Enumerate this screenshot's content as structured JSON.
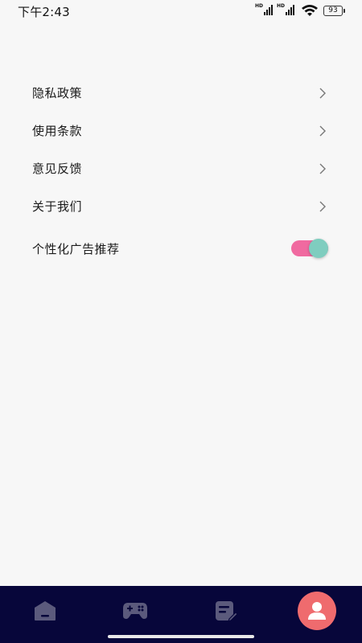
{
  "status_bar": {
    "time": "下午2:43",
    "signal_1_label": "HD",
    "signal_2_label": "HD",
    "battery": "93"
  },
  "settings": {
    "items": [
      {
        "label": "隐私政策"
      },
      {
        "label": "使用条款"
      },
      {
        "label": "意见反馈"
      },
      {
        "label": "关于我们"
      }
    ],
    "ad_toggle": {
      "label": "个性化广告推荐",
      "enabled": true,
      "track_color": "#f06aa0",
      "knob_color": "#7fcdbf"
    }
  },
  "bottom_nav": {
    "background": "#07063a",
    "active_color": "#ef6b6e",
    "items": [
      {
        "icon": "home-icon",
        "active": false
      },
      {
        "icon": "gamepad-icon",
        "active": false
      },
      {
        "icon": "notes-icon",
        "active": false
      },
      {
        "icon": "profile-icon",
        "active": true
      }
    ]
  }
}
